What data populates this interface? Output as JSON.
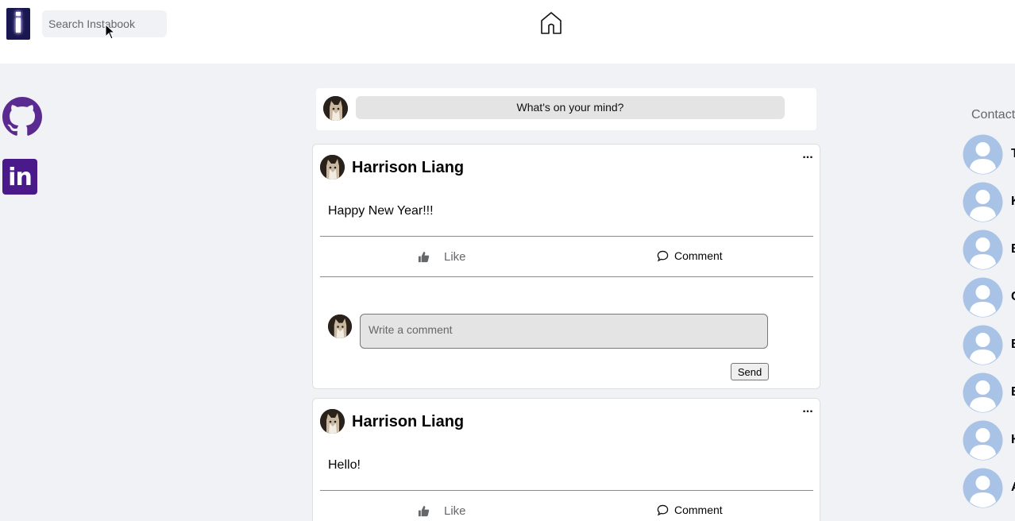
{
  "header": {
    "logo_letter": "i",
    "search_placeholder": "Search Instabook"
  },
  "sidebar": {
    "links": [
      {
        "name": "GitHub",
        "icon": "github-icon"
      },
      {
        "name": "LinkedIn",
        "icon": "linkedin-icon",
        "text": "in"
      }
    ]
  },
  "composer": {
    "prompt": "What's on your mind?"
  },
  "posts": [
    {
      "author": "Harrison Liang",
      "menu": "...",
      "text": "Happy New Year!!!",
      "like_label": "Like",
      "comment_label": "Comment",
      "comment_placeholder": "Write a comment",
      "send_label": "Send"
    },
    {
      "author": "Harrison Liang",
      "menu": "...",
      "text": "Hello!",
      "like_label": "Like",
      "comment_label": "Comment"
    }
  ],
  "contacts": {
    "title": "Contacts",
    "items": [
      {
        "initial": "T"
      },
      {
        "initial": "K"
      },
      {
        "initial": "B"
      },
      {
        "initial": "C"
      },
      {
        "initial": "B"
      },
      {
        "initial": "B"
      },
      {
        "initial": "H"
      },
      {
        "initial": "A"
      }
    ]
  },
  "colors": {
    "background": "#f0f2f5",
    "card": "#ffffff",
    "logo": "#1a1650",
    "brand_purple": "#4b1a8a",
    "contact_avatar": "#a9c3e6"
  }
}
